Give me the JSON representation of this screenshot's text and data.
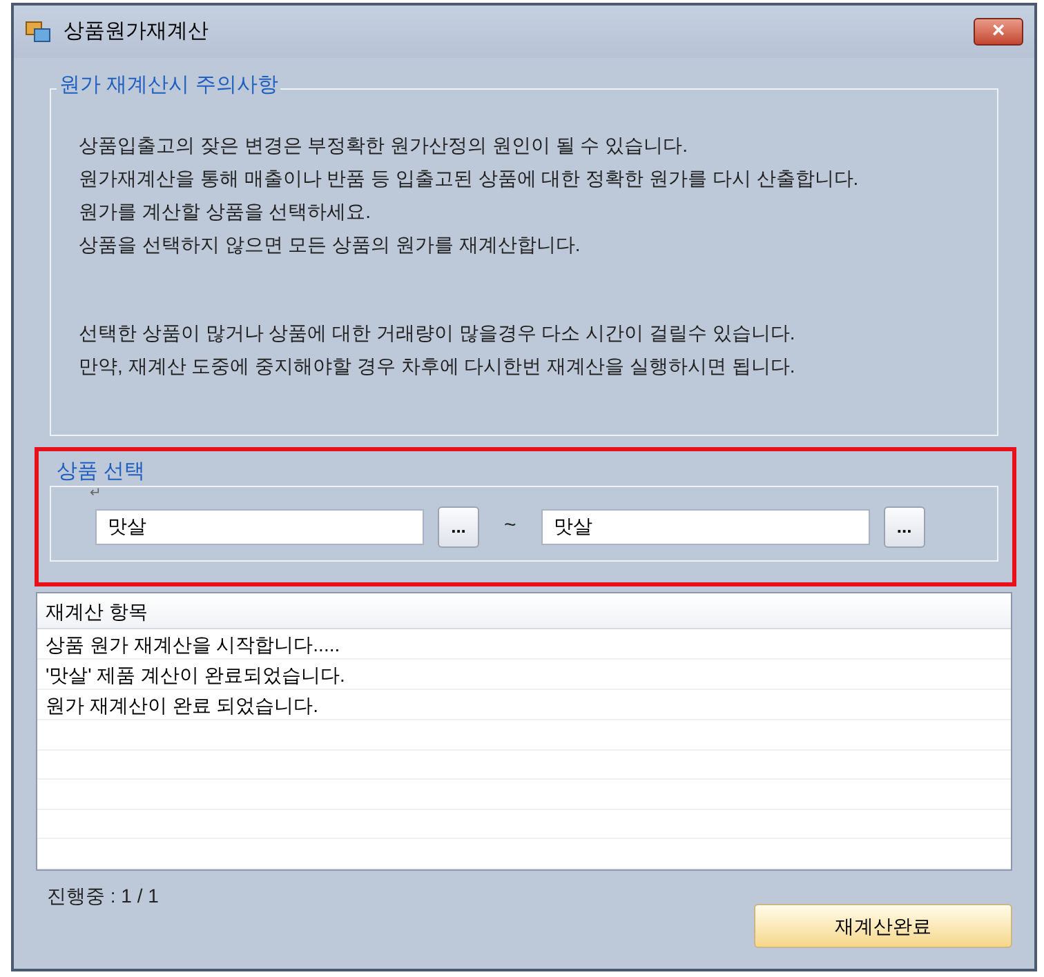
{
  "window": {
    "title": "상품원가재계산",
    "close": "×"
  },
  "notice": {
    "title": "원가 재계산시 주의사항",
    "paragraphs": [
      [
        "상품입출고의 잦은 변경은 부정확한 원가산정의 원인이 될 수 있습니다.",
        "원가재계산을 통해 매출이나 반품 등 입출고된 상품에 대한 정확한 원가를 다시 산출합니다.",
        "원가를 계산할 상품을 선택하세요.",
        "상품을 선택하지 않으면 모든 상품의 원가를 재계산합니다."
      ],
      [
        "선택한 상품이 많거나 상품에 대한 거래량이 많을경우 다소 시간이 걸릴수 있습니다.",
        "만약, 재계산 도중에 중지해야할 경우 차후에 다시한번 재계산을 실행하시면 됩니다."
      ]
    ]
  },
  "selection": {
    "title": "상품 선택",
    "mark": "↵",
    "from": {
      "value": "맛살",
      "button": "..."
    },
    "separator": "~",
    "to": {
      "value": "맛살",
      "button": "..."
    },
    "highlighted": true
  },
  "log": {
    "header": "재계산 항목",
    "rows": [
      "상품 원가 재계산을 시작합니다.....",
      "'맛살' 제품 계산이 완료되었습니다.",
      "원가 재계산이 완료 되었습니다."
    ]
  },
  "progress": "진행중 : 1 / 1",
  "done_button": "재계산완료"
}
